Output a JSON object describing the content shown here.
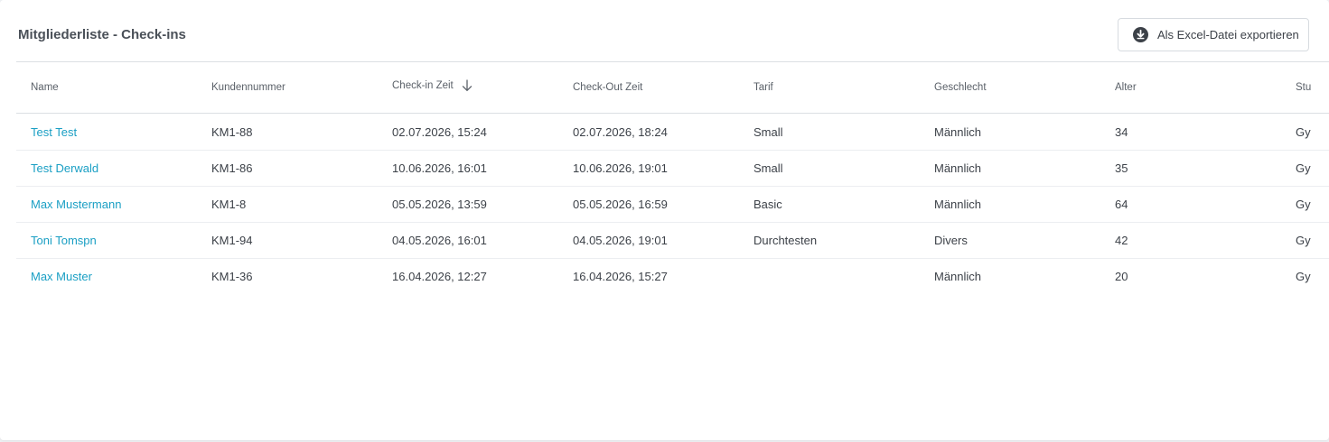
{
  "panel": {
    "title": "Mitgliederliste - Check-ins",
    "export_label": "Als Excel-Datei exportieren"
  },
  "table": {
    "headers": {
      "name": "Name",
      "kundennummer": "Kundennummer",
      "checkin": "Check-in Zeit",
      "checkout": "Check-Out Zeit",
      "tarif": "Tarif",
      "geschlecht": "Geschlecht",
      "alter": "Alter",
      "studio": "Stu"
    },
    "sort": {
      "column": "checkin",
      "direction": "descending"
    },
    "rows": [
      {
        "name": "Test Test",
        "kundennummer": "KM1-88",
        "checkin": "02.07.2026, 15:24",
        "checkout": "02.07.2026, 18:24",
        "tarif": "Small",
        "geschlecht": "Männlich",
        "alter": "34",
        "studio": "Gy"
      },
      {
        "name": "Test Derwald",
        "kundennummer": "KM1-86",
        "checkin": "10.06.2026, 16:01",
        "checkout": "10.06.2026, 19:01",
        "tarif": "Small",
        "geschlecht": "Männlich",
        "alter": "35",
        "studio": "Gy"
      },
      {
        "name": "Max Mustermann",
        "kundennummer": "KM1-8",
        "checkin": "05.05.2026, 13:59",
        "checkout": "05.05.2026, 16:59",
        "tarif": "Basic",
        "geschlecht": "Männlich",
        "alter": "64",
        "studio": "Gy"
      },
      {
        "name": "Toni Tomspn",
        "kundennummer": "KM1-94",
        "checkin": "04.05.2026, 16:01",
        "checkout": "04.05.2026, 19:01",
        "tarif": "Durchtesten",
        "geschlecht": "Divers",
        "alter": "42",
        "studio": "Gy"
      },
      {
        "name": "Max Muster",
        "kundennummer": "KM1-36",
        "checkin": "16.04.2026, 12:27",
        "checkout": "16.04.2026, 15:27",
        "tarif": "",
        "geschlecht": "Männlich",
        "alter": "20",
        "studio": "Gy"
      }
    ]
  },
  "colors": {
    "link": "#1a9fc4",
    "text": "#3c4148",
    "header_text": "#5a6068",
    "border": "#dcdfe3"
  },
  "icons": {
    "export": "download-circle-icon",
    "sort": "arrow-down-icon"
  }
}
